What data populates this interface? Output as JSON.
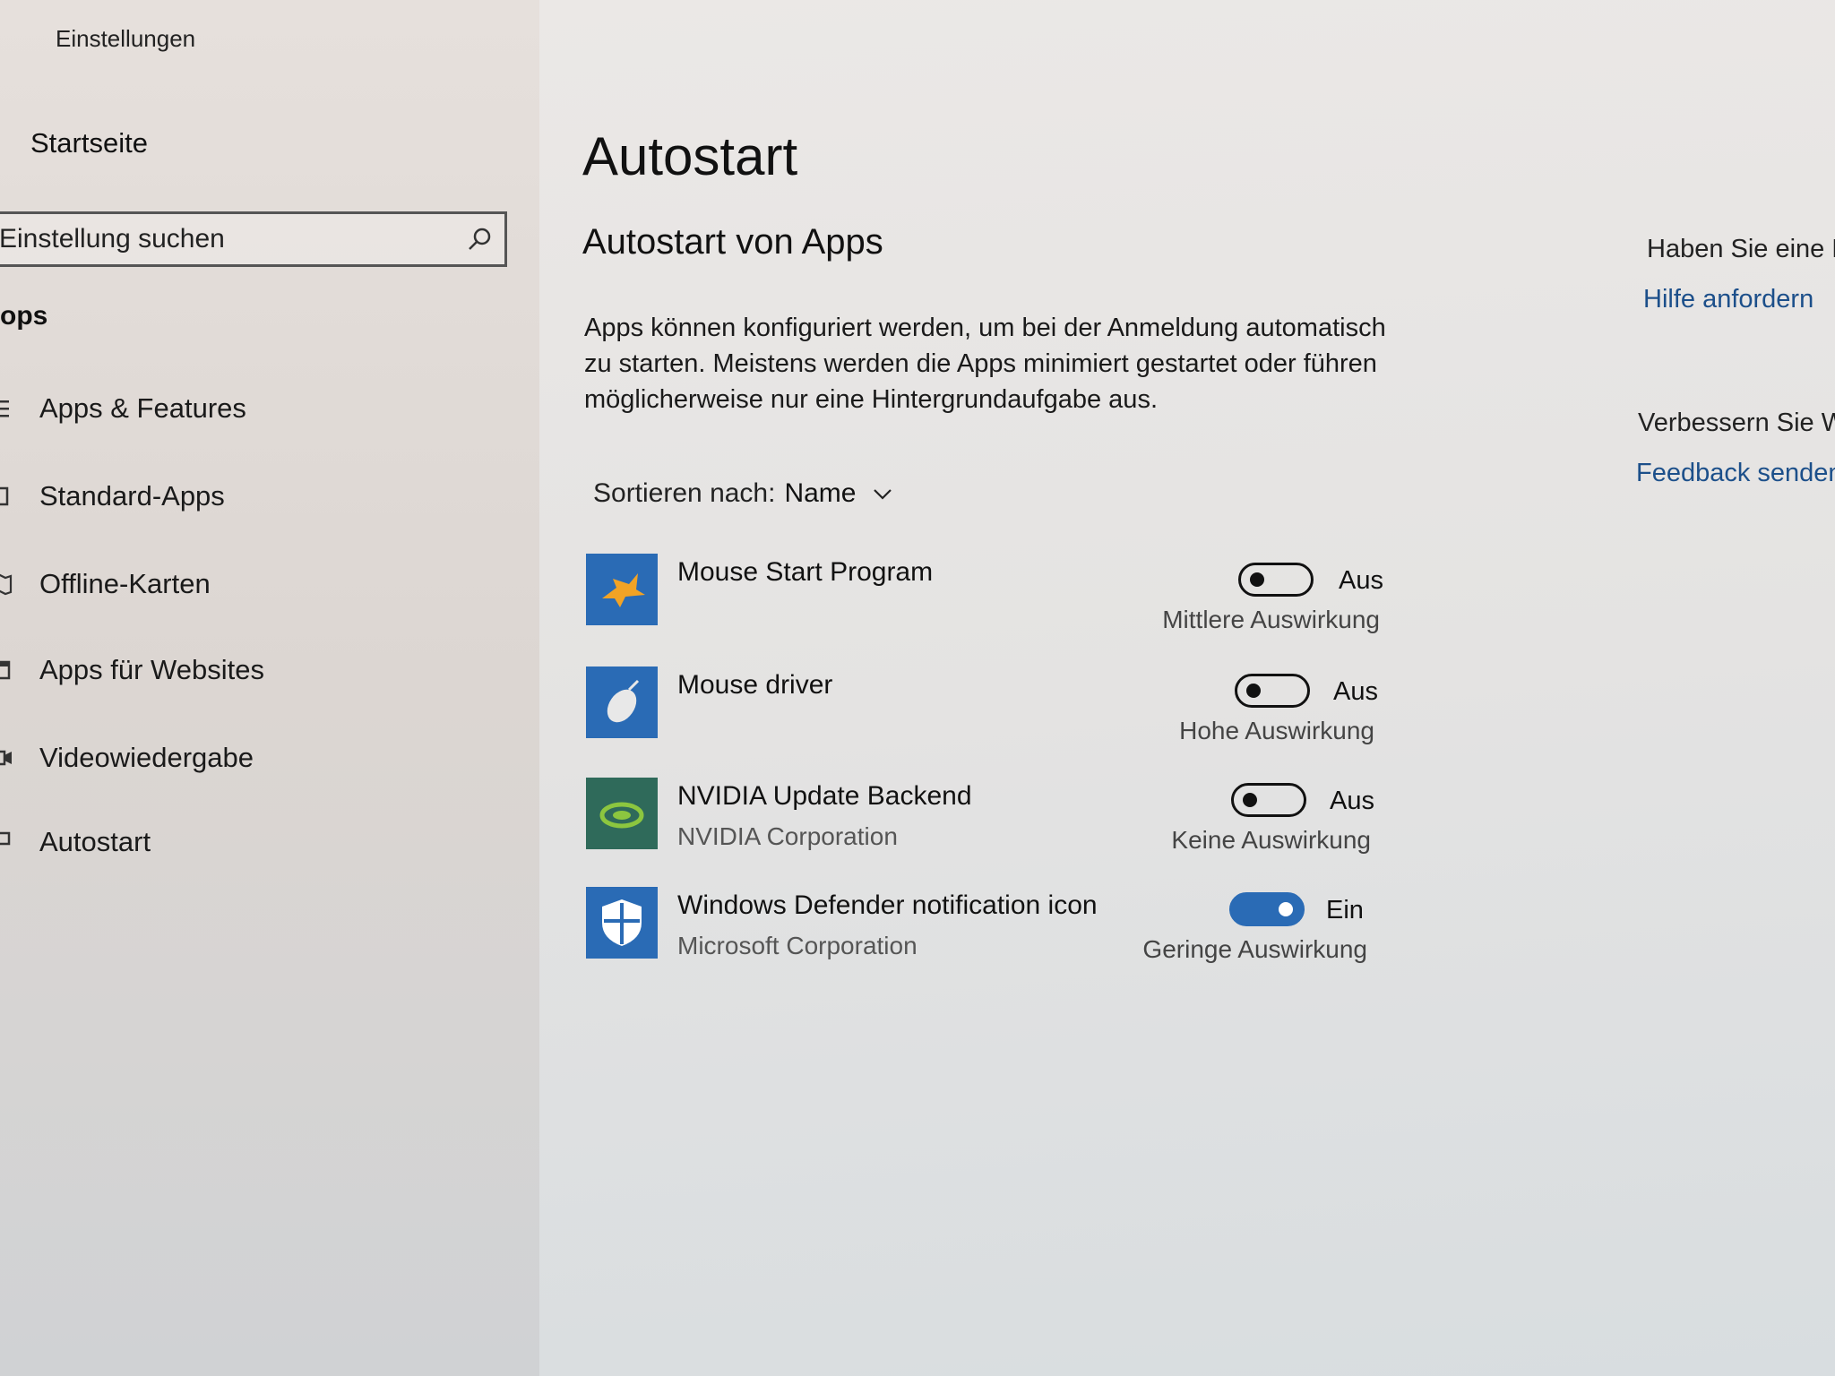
{
  "window": {
    "title": "Einstellungen"
  },
  "sidebar": {
    "home": "Startseite",
    "search": {
      "placeholder": "Einstellung suchen"
    },
    "section": "ops",
    "items": [
      {
        "label": "Apps & Features",
        "icon": "list-icon"
      },
      {
        "label": "Standard-Apps",
        "icon": "default-apps-icon"
      },
      {
        "label": "Offline-Karten",
        "icon": "map-icon"
      },
      {
        "label": "Apps für Websites",
        "icon": "web-apps-icon"
      },
      {
        "label": "Videowiedergabe",
        "icon": "video-icon"
      },
      {
        "label": "Autostart",
        "icon": "startup-icon"
      }
    ]
  },
  "main": {
    "title": "Autostart",
    "subtitle": "Autostart von Apps",
    "description": "Apps können konfiguriert werden, um bei der Anmeldung automatisch zu starten. Meistens werden die Apps minimiert gestartet oder führen möglicherweise nur eine Hintergrundaufgabe aus.",
    "sort": {
      "label": "Sortieren nach:",
      "value": "Name"
    },
    "apps": [
      {
        "name": "Mouse Start Program",
        "publisher": "",
        "state": "Aus",
        "on": false,
        "impact": "Mittlere Auswirkung"
      },
      {
        "name": "Mouse driver",
        "publisher": "",
        "state": "Aus",
        "on": false,
        "impact": "Hohe Auswirkung"
      },
      {
        "name": "NVIDIA Update Backend",
        "publisher": "NVIDIA Corporation",
        "state": "Aus",
        "on": false,
        "impact": "Keine Auswirkung"
      },
      {
        "name": "Windows Defender notification icon",
        "publisher": "Microsoft Corporation",
        "state": "Ein",
        "on": true,
        "impact": "Geringe Auswirkung"
      }
    ]
  },
  "right": {
    "question": "Haben Sie eine F",
    "help_link": "Hilfe anfordern",
    "improve": "Verbessern Sie W",
    "feedback_link": "Feedback senden"
  },
  "colors": {
    "accent": "#2a6bb5",
    "link": "#1c4f8a"
  }
}
